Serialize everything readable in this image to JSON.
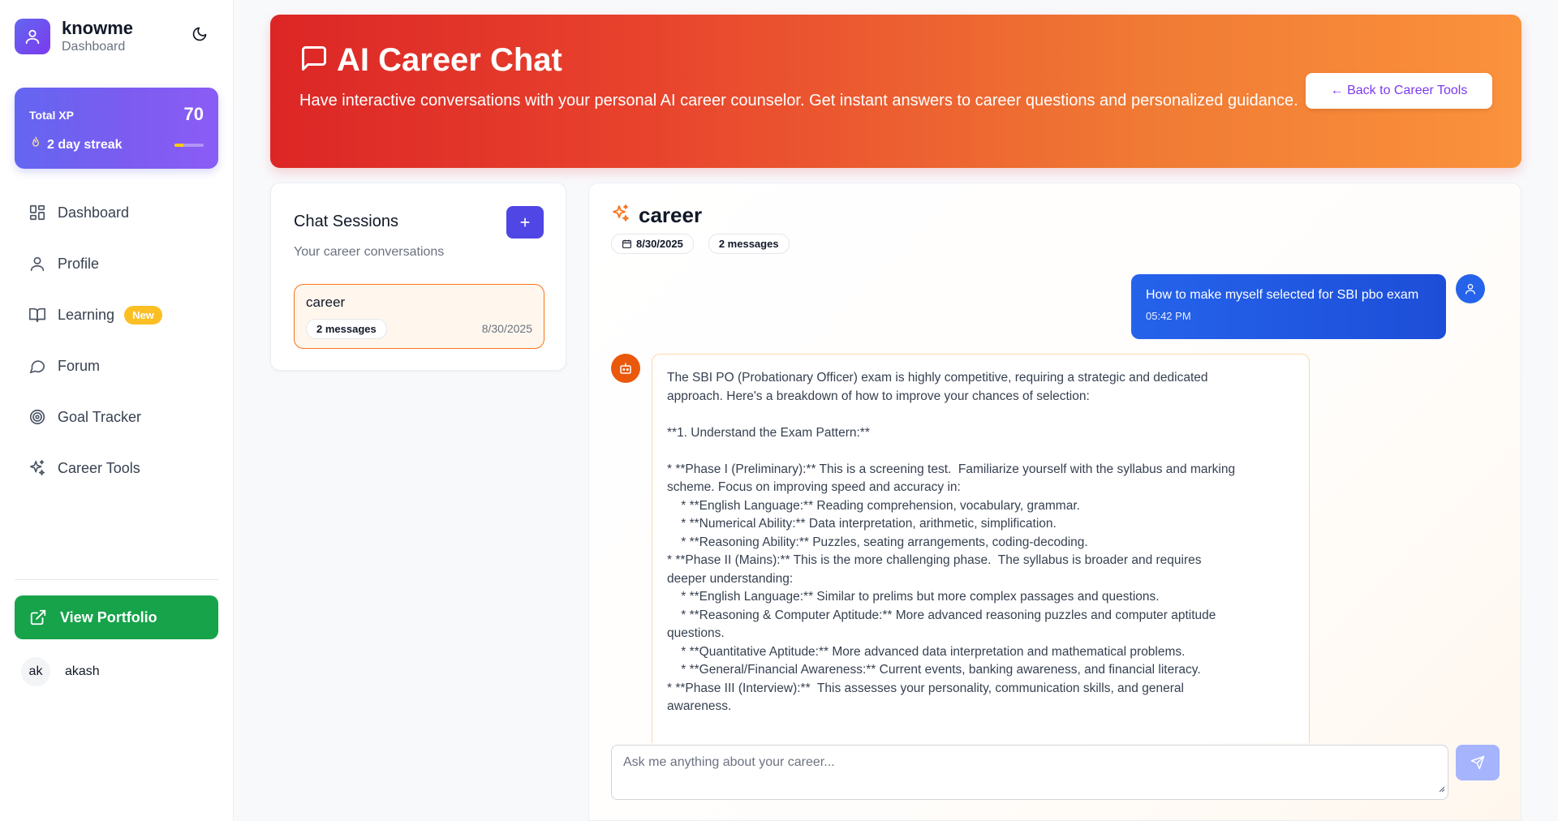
{
  "sidebar": {
    "brand_name": "knowme",
    "brand_sub": "Dashboard",
    "xp": {
      "label": "Total XP",
      "value": "70",
      "streak": "2 day streak",
      "progress": 0.3
    },
    "items": [
      {
        "label": "Dashboard",
        "icon": "grid-icon"
      },
      {
        "label": "Profile",
        "icon": "user-icon"
      },
      {
        "label": "Learning",
        "icon": "book-icon",
        "badge": "New"
      },
      {
        "label": "Forum",
        "icon": "chat-bubble-icon"
      },
      {
        "label": "Goal Tracker",
        "icon": "target-icon"
      },
      {
        "label": "Career Tools",
        "icon": "sparkles-icon"
      }
    ],
    "portfolio_label": "View Portfolio",
    "user": {
      "initials": "ak",
      "name": "akash"
    }
  },
  "hero": {
    "title": "AI Career Chat",
    "description": "Have interactive conversations with your personal AI career counselor. Get instant answers to career questions and personalized guidance.",
    "back_label": "← Back to Career Tools"
  },
  "sessions": {
    "title": "Chat Sessions",
    "subtitle": "Your career conversations",
    "add_label": "+",
    "items": [
      {
        "name": "career",
        "count": "2 messages",
        "date": "8/30/2025"
      }
    ]
  },
  "chat": {
    "title": "career",
    "date": "8/30/2025",
    "count": "2 messages",
    "user_message": {
      "text": "How to make myself selected for SBI pbo exam",
      "time": "05:42 PM"
    },
    "bot_lines": [
      "The SBI PO (Probationary Officer) exam is highly competitive, requiring a strategic and dedicated",
      "approach. Here's a breakdown of how to improve your chances of selection:",
      "",
      "**1. Understand the Exam Pattern:**",
      "",
      "* **Phase I (Preliminary):** This is a screening test.  Familiarize yourself with the syllabus and marking",
      "scheme. Focus on improving speed and accuracy in:",
      "    * **English Language:** Reading comprehension, vocabulary, grammar.",
      "    * **Numerical Ability:** Data interpretation, arithmetic, simplification.",
      "    * **Reasoning Ability:** Puzzles, seating arrangements, coding-decoding.",
      "* **Phase II (Mains):** This is the more challenging phase.  The syllabus is broader and requires",
      "deeper understanding:",
      "    * **English Language:** Similar to prelims but more complex passages and questions.",
      "    * **Reasoning & Computer Aptitude:** More advanced reasoning puzzles and computer aptitude",
      "questions.",
      "    * **Quantitative Aptitude:** More advanced data interpretation and mathematical problems.",
      "    * **General/Financial Awareness:** Current events, banking awareness, and financial literacy.",
      "* **Phase III (Interview):**  This assesses your personality, communication skills, and general",
      "awareness."
    ],
    "input_placeholder": "Ask me anything about your career..."
  },
  "colors": {
    "accent": "#4f46e5",
    "hero_start": "#dc2626",
    "hero_end": "#fb923c",
    "success": "#16a34a",
    "user_bubble": "#2563eb",
    "bot_avatar": "#ea580c"
  }
}
